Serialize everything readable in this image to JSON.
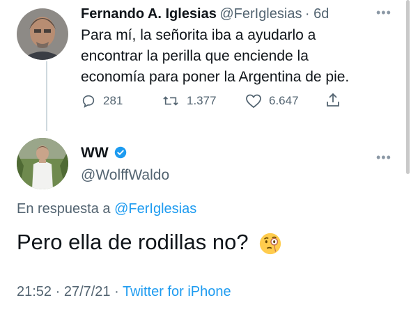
{
  "tweet": {
    "author_name": "Fernando A. Iglesias",
    "author_handle": "@FerIglesias",
    "age": "· 6d",
    "text_lines": [
      "Para mí, la señorita iba a ayudarlo a",
      "encontrar la perilla que enciende la",
      "economía para poner la Argentina de pie."
    ],
    "replies": "281",
    "retweets": "1.377",
    "likes": "6.647"
  },
  "reply": {
    "author_name": "WW",
    "author_handle": "@WolffWaldo",
    "replying_to_prefix": "En respuesta a",
    "replying_to_handle": "@FerIglesias",
    "text": "Pero ella de rodillas no?",
    "timestamp": "21:52 · 27/7/21 ·",
    "source": "Twitter for iPhone"
  },
  "icons": {
    "more": "more-dots-icon",
    "reply": "reply-bubble-icon",
    "retweet": "retweet-icon",
    "like": "heart-icon",
    "share": "share-icon",
    "verified": "verified-badge-icon",
    "emoji": "face-with-monocle-emoji"
  },
  "colors": {
    "link": "#1d9bf0",
    "muted": "#536471",
    "text": "#0f1419"
  }
}
